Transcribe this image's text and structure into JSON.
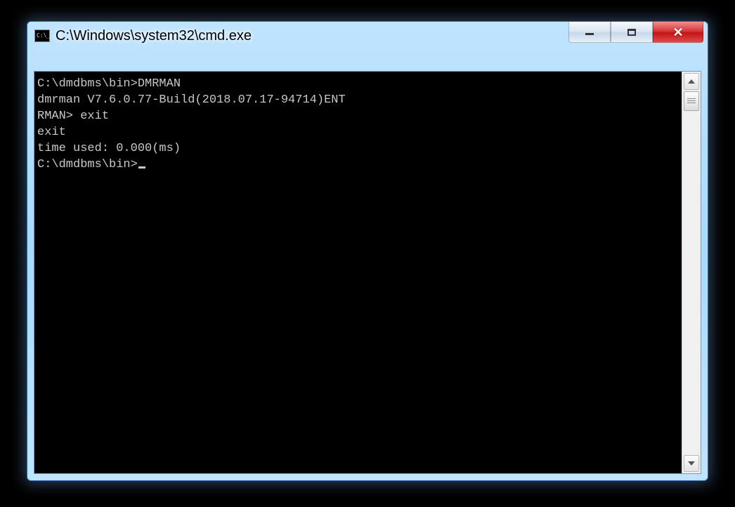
{
  "window": {
    "title": "C:\\Windows\\system32\\cmd.exe",
    "icon_label": "C:\\_"
  },
  "console": {
    "lines": [
      "C:\\dmdbms\\bin>DMRMAN",
      "dmrman V7.6.0.77-Build(2018.07.17-94714)ENT",
      "RMAN> exit",
      "exit",
      "time used: 0.000(ms)",
      "",
      "C:\\dmdbms\\bin>"
    ],
    "cursor_line_index": 6
  }
}
